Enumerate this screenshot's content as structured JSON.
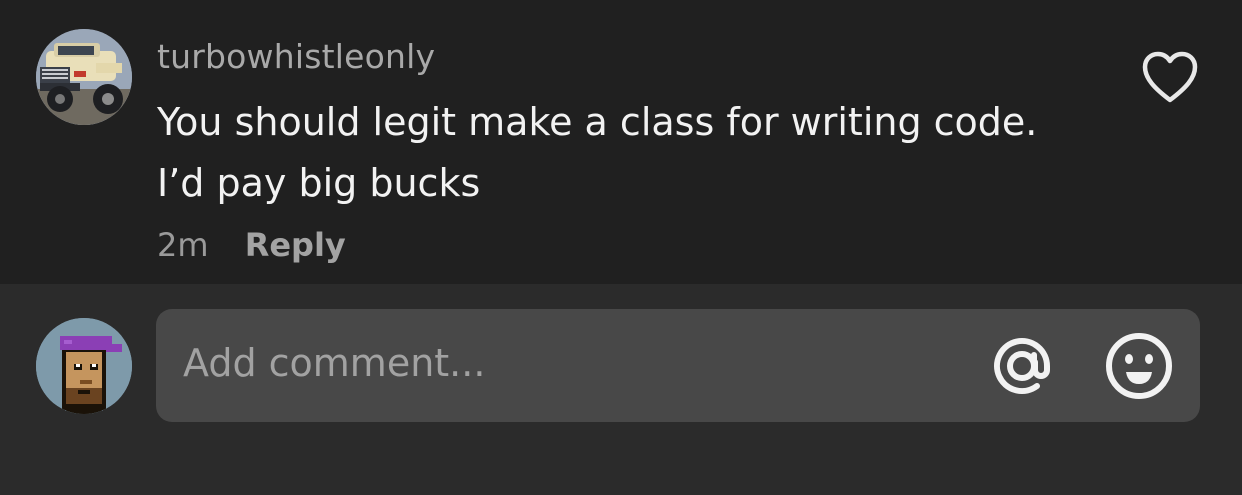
{
  "comment": {
    "username": "turbowhistleonly",
    "text_lines": [
      "You should legit make a class for writing code.",
      "I’d pay big bucks"
    ],
    "timestamp": "2m",
    "reply_label": "Reply",
    "avatar_icon": "truck-photo-icon",
    "like_icon": "heart-outline-icon"
  },
  "composer": {
    "placeholder": "Add comment...",
    "avatar_icon": "pixel-character-avatar-icon",
    "mention_icon": "at-sign-icon",
    "emoji_icon": "smiley-face-icon"
  },
  "colors": {
    "comment_background": "#202020",
    "composer_background": "#2b2b2b",
    "input_background": "#484848",
    "primary_text": "#f2f2f2",
    "secondary_text": "#a9a9a9",
    "icon_color": "#f2f2f2"
  }
}
